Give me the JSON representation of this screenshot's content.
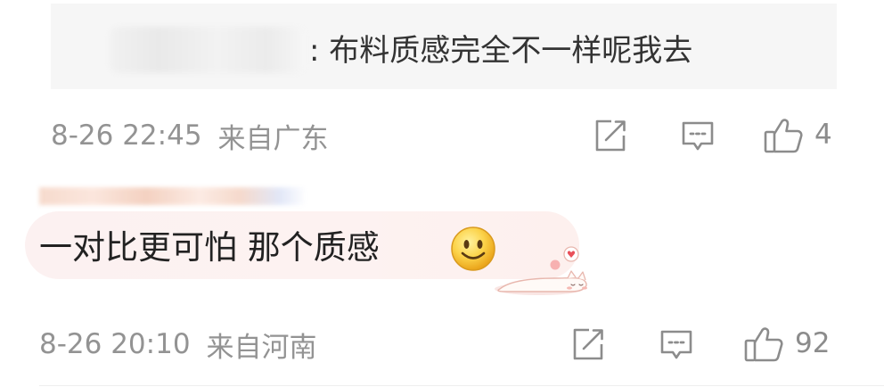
{
  "comment1": {
    "quote_text": ": 布料质感完全不一样呢我去",
    "time": "8-26 22:45",
    "location": "来自广东",
    "like_count": "4"
  },
  "comment2": {
    "text": "一对比更可怕 那个质感",
    "emoji": "smile-emoji",
    "time": "8-26 20:10",
    "location": "来自河南",
    "like_count": "92"
  },
  "icons": {
    "share": "share-icon",
    "comment": "comment-icon",
    "like": "thumbs-up-icon"
  },
  "colors": {
    "text_primary": "#222222",
    "text_meta": "#939393",
    "quote_background": "#f6f6f6",
    "bubble_background": "#fcf1f1"
  }
}
